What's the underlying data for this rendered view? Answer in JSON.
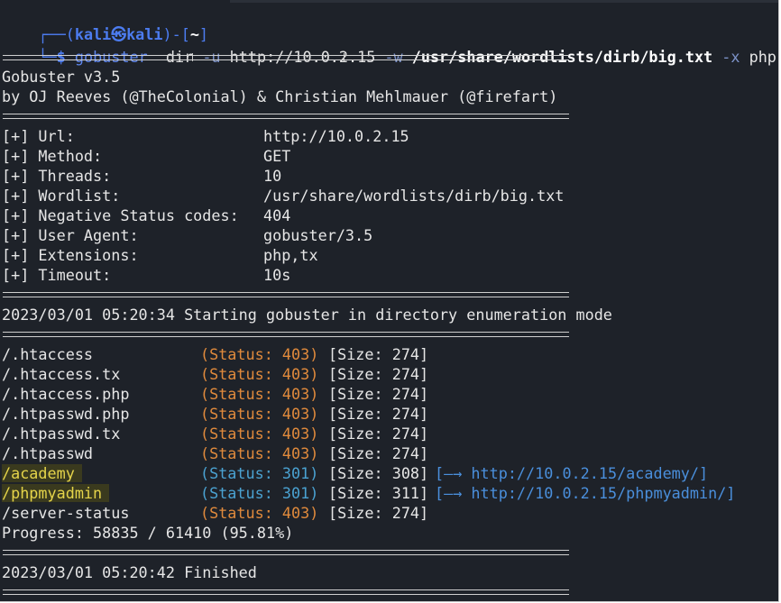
{
  "prompt": {
    "open_paren": "(",
    "user": "kali",
    "at_symbol": "㉿",
    "host": "kali",
    "close_paren": ")",
    "dir_open": "-[",
    "dir": "~",
    "dir_close": "]",
    "dollar": "$"
  },
  "command": {
    "program": "gobuster",
    "subcommand": "dir",
    "flag_u": "-u",
    "url": "http://10.0.2.15",
    "flag_w": "-w",
    "wordlist": "/usr/share/wordlists/dirb/big.txt",
    "flag_x": "-x",
    "extensions": "php,tx"
  },
  "banner": {
    "version": "Gobuster v3.5",
    "authors": "by OJ Reeves (@TheColonial) & Christian Mehlmauer (@firefart)"
  },
  "config": [
    {
      "label": "[+] Url:",
      "value": "http://10.0.2.15"
    },
    {
      "label": "[+] Method:",
      "value": "GET"
    },
    {
      "label": "[+] Threads:",
      "value": "10"
    },
    {
      "label": "[+] Wordlist:",
      "value": "/usr/share/wordlists/dirb/big.txt"
    },
    {
      "label": "[+] Negative Status codes:",
      "value": "404"
    },
    {
      "label": "[+] User Agent:",
      "value": "gobuster/3.5"
    },
    {
      "label": "[+] Extensions:",
      "value": "php,tx"
    },
    {
      "label": "[+] Timeout:",
      "value": "10s"
    }
  ],
  "start_message": "2023/03/01 05:20:34 Starting gobuster in directory enumeration mode",
  "results": [
    {
      "path": "/.htaccess",
      "status": "(Status: 403)",
      "size": "[Size: 274]",
      "redirect": ""
    },
    {
      "path": "/.htaccess.tx",
      "status": "(Status: 403)",
      "size": "[Size: 274]",
      "redirect": ""
    },
    {
      "path": "/.htaccess.php",
      "status": "(Status: 403)",
      "size": "[Size: 274]",
      "redirect": ""
    },
    {
      "path": "/.htpasswd.php",
      "status": "(Status: 403)",
      "size": "[Size: 274]",
      "redirect": ""
    },
    {
      "path": "/.htpasswd.tx",
      "status": "(Status: 403)",
      "size": "[Size: 274]",
      "redirect": ""
    },
    {
      "path": "/.htpasswd",
      "status": "(Status: 403)",
      "size": "[Size: 274]",
      "redirect": ""
    },
    {
      "path": "/academy",
      "status": "(Status: 301)",
      "size": "[Size: 308]",
      "redirect": "[—→ http://10.0.2.15/academy/]"
    },
    {
      "path": "/phpmyadmin",
      "status": "(Status: 301)",
      "size": "[Size: 311]",
      "redirect": "[—→ http://10.0.2.15/phpmyadmin/]"
    },
    {
      "path": "/server-status",
      "status": "(Status: 403)",
      "size": "[Size: 274]",
      "redirect": ""
    }
  ],
  "progress": "Progress: 58835 / 61410 (95.81%)",
  "finished_message": "2023/03/01 05:20:42 Finished",
  "colors": {
    "background": "#1e2229",
    "prompt_blue": "#4c7cf0",
    "status_403": "#e08a3c",
    "status_301": "#4aa2d2",
    "highlight_text": "#e5d44a"
  }
}
